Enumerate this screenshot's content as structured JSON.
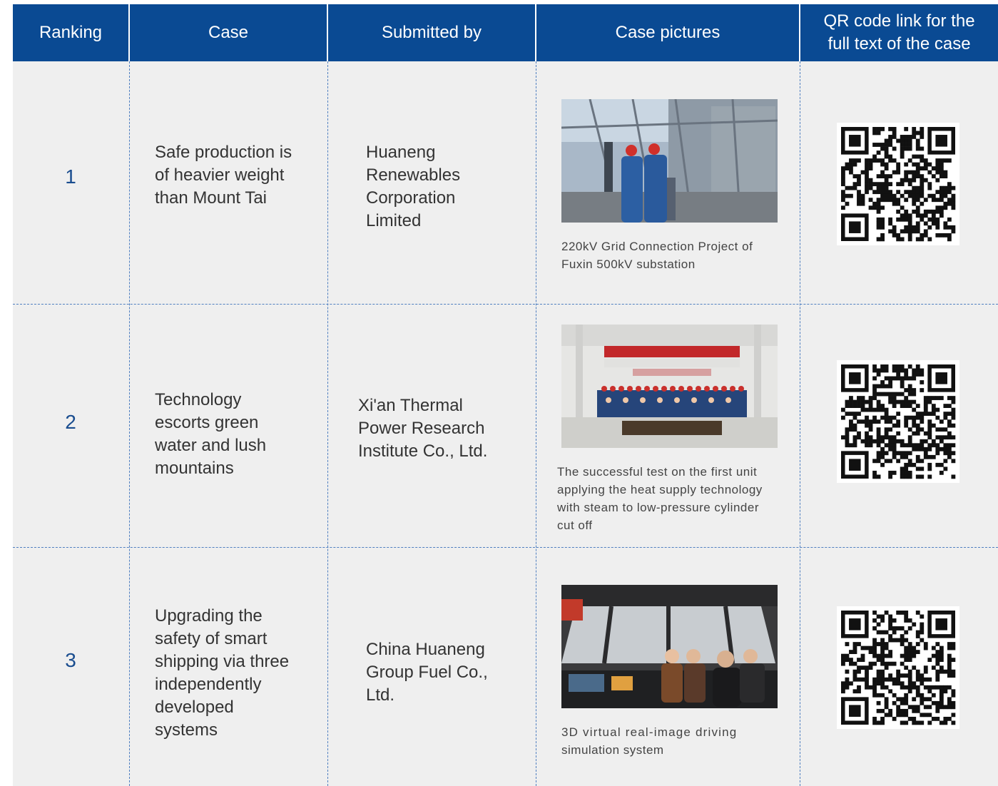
{
  "header": {
    "ranking": "Ranking",
    "case": "Case",
    "submitted_by": "Submitted by",
    "case_pictures": "Case pictures",
    "qr_line1": "QR code link for the",
    "qr_line2": "full text of the case"
  },
  "rows": [
    {
      "rank": "1",
      "case_lines": [
        "Safe production is",
        "of heavier weight",
        "than Mount Tai"
      ],
      "submitter_lines": [
        "Huaneng",
        "Renewables",
        "Corporation",
        "Limited"
      ],
      "caption_lines": [
        "220kV Grid Connection Project of",
        "Fuxin 500kV substation"
      ]
    },
    {
      "rank": "2",
      "case_lines": [
        "Technology",
        "escorts green",
        "water and lush",
        "mountains"
      ],
      "submitter_lines": [
        "Xi'an Thermal",
        "Power Research",
        "Institute Co., Ltd."
      ],
      "caption_lines": [
        "The successful test on the first unit",
        "applying the heat supply technology",
        "with steam to low-pressure cylinder",
        "cut off"
      ]
    },
    {
      "rank": "3",
      "case_lines": [
        "Upgrading the",
        "safety of smart",
        "shipping via three",
        "independently",
        "developed",
        "systems"
      ],
      "submitter_lines": [
        "China Huaneng",
        "Group Fuel Co.,",
        "Ltd."
      ],
      "caption_lines": [
        "3D virtual real-image driving",
        "simulation system"
      ]
    }
  ],
  "colors": {
    "header_bg": "#0a4a93",
    "table_bg": "#efefef",
    "rank_text": "#1a4d8f",
    "divider": "#4f7fc0"
  },
  "icons": [
    "qr-code-icon"
  ]
}
